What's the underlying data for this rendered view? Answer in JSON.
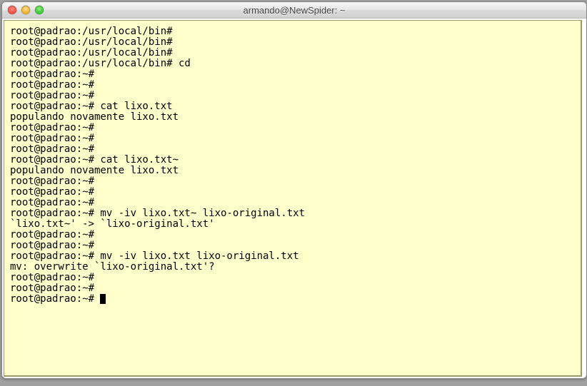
{
  "window": {
    "title": "armando@NewSpider: ~"
  },
  "terminal": {
    "lines": [
      "root@padrao:/usr/local/bin#",
      "root@padrao:/usr/local/bin#",
      "root@padrao:/usr/local/bin#",
      "root@padrao:/usr/local/bin# cd",
      "root@padrao:~#",
      "root@padrao:~#",
      "root@padrao:~#",
      "root@padrao:~# cat lixo.txt",
      "populando novamente lixo.txt",
      "root@padrao:~#",
      "root@padrao:~#",
      "root@padrao:~#",
      "root@padrao:~# cat lixo.txt~",
      "populando novamente lixo.txt",
      "root@padrao:~#",
      "root@padrao:~#",
      "root@padrao:~#",
      "root@padrao:~# mv -iv lixo.txt~ lixo-original.txt",
      "`lixo.txt~' -> `lixo-original.txt'",
      "root@padrao:~#",
      "root@padrao:~#",
      "root@padrao:~# mv -iv lixo.txt lixo-original.txt",
      "mv: overwrite `lixo-original.txt'?",
      "root@padrao:~#",
      "root@padrao:~#"
    ],
    "current_prompt": "root@padrao:~# "
  }
}
